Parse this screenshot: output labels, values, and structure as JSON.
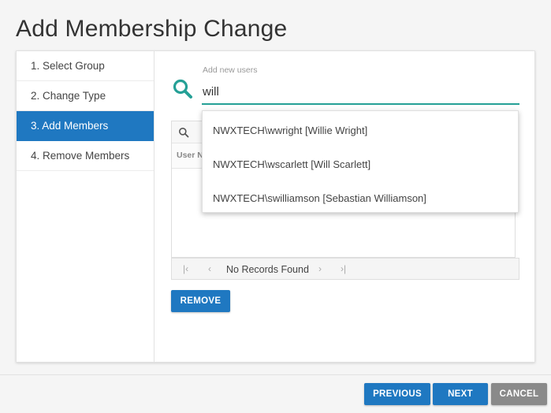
{
  "page": {
    "title": "Add Membership Change"
  },
  "steps": [
    {
      "label": "1. Select Group"
    },
    {
      "label": "2. Change Type"
    },
    {
      "label": "3. Add Members"
    },
    {
      "label": "4. Remove Members"
    }
  ],
  "search": {
    "label": "Add new users",
    "value": "will"
  },
  "suggestions": [
    "NWXTECH\\wwright [Willie Wright]",
    "NWXTECH\\wscarlett [Will Scarlett]",
    "NWXTECH\\swilliamson [Sebastian Williamson]"
  ],
  "grid": {
    "header_partial": "User N",
    "pager_text": "No Records Found"
  },
  "buttons": {
    "remove": "REMOVE",
    "previous": "PREVIOUS",
    "next": "NEXT",
    "cancel": "CANCEL"
  },
  "colors": {
    "primary": "#1f78c1",
    "accent": "#25a096",
    "cancel": "#8a8a8a"
  }
}
